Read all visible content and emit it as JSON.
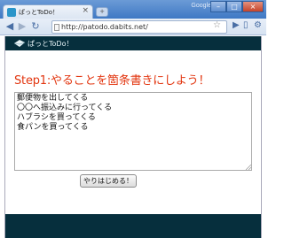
{
  "browser": {
    "tab_title": "ぱっとToDo！",
    "tab_close": "×",
    "new_tab": "+",
    "brand": "Google",
    "window_buttons": {
      "minimize": "–",
      "maximize": "□",
      "close": "×"
    },
    "nav": {
      "back": "◀",
      "forward": "▶",
      "reload": "↻",
      "star": "☆"
    },
    "url": "http://patodo.dabits.net/",
    "toolbar_right": {
      "go": "▶",
      "page": "▯",
      "tools": "⚙"
    }
  },
  "header": {
    "logo_text": "ぱっとToDo！",
    "logo_icon": "folded-paper-icon"
  },
  "main": {
    "step_title": "Step1:やることを箇条書きにしよう！",
    "todo_lines": [
      "郵便物を出してくる",
      "〇〇へ振込みに行ってくる",
      "ハブラシを買ってくる",
      "食パンを買ってくる"
    ],
    "start_button": "やりはじめる！"
  },
  "colors": {
    "header_bg": "#062f3d",
    "title_red": "#e2350f"
  }
}
